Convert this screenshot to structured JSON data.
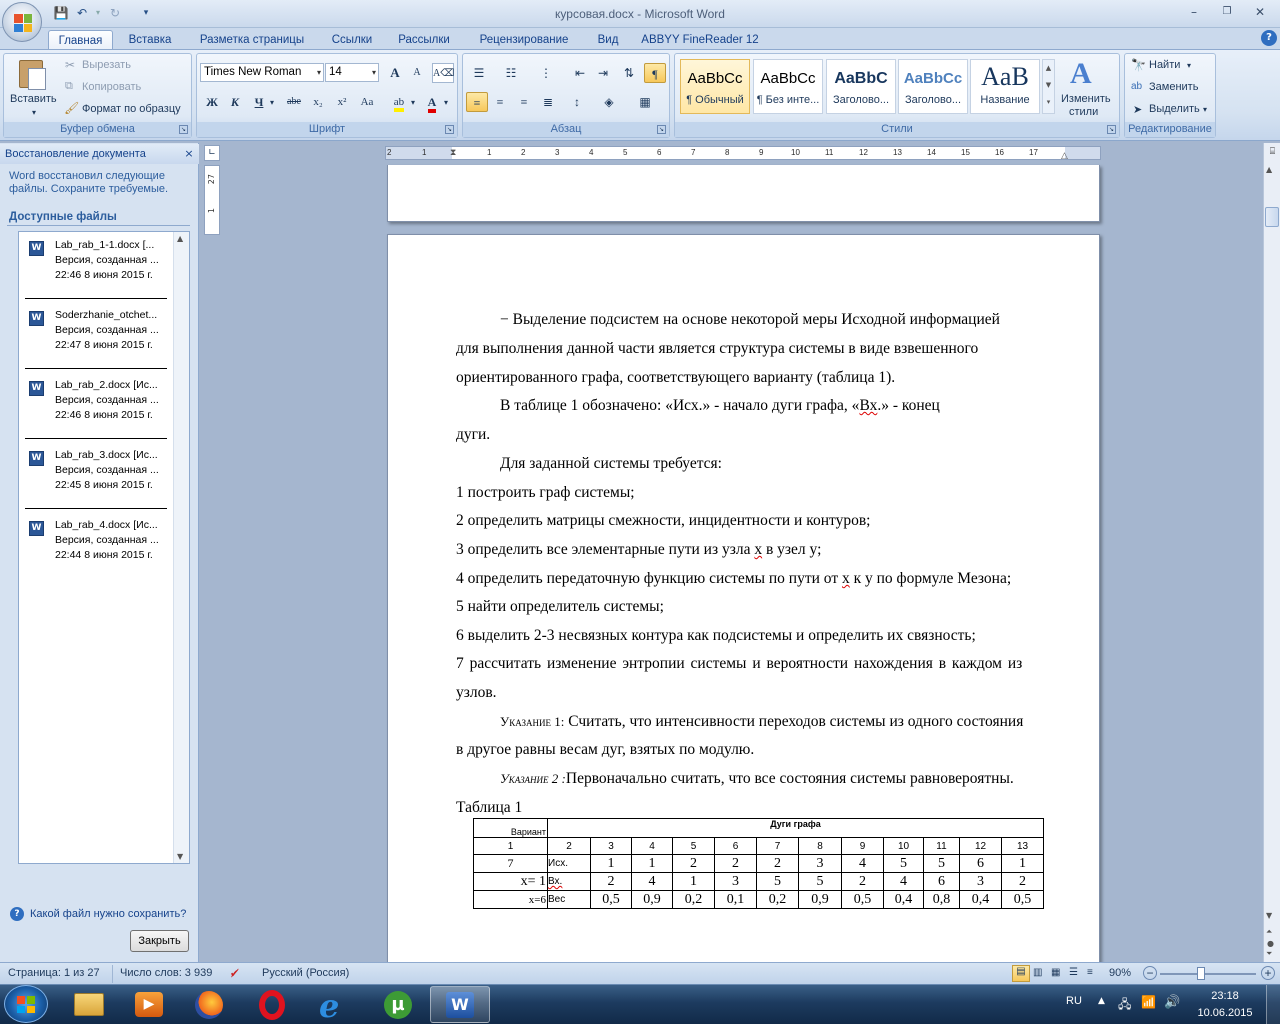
{
  "window": {
    "title": "курсовая.docx - Microsoft Word"
  },
  "ribbon": {
    "tabs": [
      "Главная",
      "Вставка",
      "Разметка страницы",
      "Ссылки",
      "Рассылки",
      "Рецензирование",
      "Вид",
      "ABBYY FineReader 12"
    ],
    "clipboard": {
      "paste": "Вставить",
      "cut": "Вырезать",
      "copy": "Копировать",
      "format_painter": "Формат по образцу",
      "label": "Буфер обмена"
    },
    "font": {
      "name": "Times New Roman",
      "size": "14",
      "label": "Шрифт",
      "bold": "Ж",
      "italic": "К",
      "underline": "Ч",
      "strike": "abe",
      "sub": "x₂",
      "sup": "x²",
      "case": "Aa",
      "grow": "A",
      "shrink": "A"
    },
    "paragraph": {
      "label": "Абзац"
    },
    "styles": {
      "label": "Стили",
      "items": [
        {
          "sample": "AaBbCc",
          "name": "¶ Обычный"
        },
        {
          "sample": "AaBbCc",
          "name": "¶ Без инте..."
        },
        {
          "sample": "AaBbC",
          "name": "Заголово..."
        },
        {
          "sample": "AaBbCc",
          "name": "Заголово..."
        },
        {
          "sample": "AaB",
          "name": "Название"
        }
      ],
      "change": "Изменить",
      "change2": "стили"
    },
    "editing": {
      "find": "Найти",
      "replace": "Заменить",
      "select": "Выделить",
      "label": "Редактирование"
    }
  },
  "ruler": {
    "numbers": [
      "2",
      "1",
      "1",
      "2",
      "3",
      "4",
      "5",
      "6",
      "7",
      "8",
      "9",
      "10",
      "11",
      "12",
      "13",
      "14",
      "15",
      "16",
      "17"
    ],
    "vnumbers": [
      "27",
      "1"
    ]
  },
  "taskpane": {
    "title": "Восстановление документа",
    "intro1": "Word восстановил следующие",
    "intro2": "файлы.  Сохраните требуемые.",
    "available": "Доступные файлы",
    "files": [
      {
        "name": "Lab_rab_1-1.docx  [...",
        "line2": "Версия, созданная ...",
        "time": "22:46 8 июня 2015 г."
      },
      {
        "name": "Soderzhanie_otchet...",
        "line2": "Версия, созданная ...",
        "time": "22:47 8 июня 2015 г."
      },
      {
        "name": "Lab_rab_2.docx  [Ис...",
        "line2": "Версия, созданная ...",
        "time": "22:46 8 июня 2015 г."
      },
      {
        "name": "Lab_rab_3.docx  [Ис...",
        "line2": "Версия, созданная ...",
        "time": "22:45 8 июня 2015 г."
      },
      {
        "name": "Lab_rab_4.docx  [Ис...",
        "line2": "Версия, созданная ...",
        "time": "22:44 8 июня 2015 г."
      }
    ],
    "help": "Какой файл нужно сохранить?",
    "close": "Закрыть"
  },
  "document": {
    "p1a": "− Выделение подсистем на основе некоторой меры Исходной информацией",
    "p1b": "для выполнения данной части является структура системы в виде взвешенного",
    "p1c": "ориентированного графа, соответствующего варианту (таблица 1).",
    "p2a_pre": "В таблице 1 обозначено: «Исх.» - начало дуги графа, «",
    "p2a_vx": "Вх",
    "p2a_post": ".» - конец",
    "p2b": "дуги.",
    "p3": "Для заданной системы требуется:",
    "list": [
      "1  построить граф системы;",
      "2  определить матрицы смежности, инцидентности и контуров;",
      "3  определить все элементарные пути из узла х в узел у;",
      "4  определить передаточную функцию системы по пути от х к у по формуле Мезона;",
      "5  найти определитель системы;",
      "6  выделить 2-3 несвязных контура как подсистемы и определить их связность;",
      "7  рассчитать изменение энтропии системы и вероятности нахождения в каждом из"
    ],
    "item3_pre": "3  определить все элементарные пути из узла ",
    "item3_x": "х",
    "item3_post": " в узел у;",
    "item4_pre": "4  определить передаточную функцию системы по пути от ",
    "item4_x": "х",
    "item4_post": " к у по формуле Мезона;",
    "list7b": "узлов.",
    "note1_label": "Указание 1:",
    "note1_text": " Считать, что интенсивности переходов системы из одного состояния",
    "note1b": "в другое равны весам дуг, взятых по модулю.",
    "note2_label": "Указание 2 :",
    "note2_text": "Первоначально считать, что все состояния системы равновероятны.",
    "table_caption": "Таблица 1",
    "table": {
      "variant": "Вариант",
      "arcs": "Дуги графа",
      "header_row": [
        "1",
        "2",
        "3",
        "4",
        "5",
        "6",
        "7",
        "8",
        "9",
        "10",
        "11",
        "12",
        "13"
      ],
      "row_variant": "7",
      "label_src": "Исх.",
      "label_dst": "Вх.",
      "label_weight": "Вес",
      "x_eq": "x= 1",
      "x_eq2": "x=6",
      "src": [
        "1",
        "1",
        "2",
        "2",
        "2",
        "3",
        "4",
        "5",
        "5",
        "6",
        "1"
      ],
      "dst": [
        "2",
        "4",
        "1",
        "3",
        "5",
        "5",
        "2",
        "4",
        "6",
        "3",
        "2"
      ],
      "weight": [
        "0,5",
        "0,9",
        "0,2",
        "0,1",
        "0,2",
        "0,9",
        "0,5",
        "0,4",
        "0,8",
        "0,4",
        "0,5"
      ]
    }
  },
  "statusbar": {
    "page": "Страница: 1 из 27",
    "words": "Число слов: 3 939",
    "lang": "Русский (Россия)",
    "zoom": "90%"
  },
  "taskbar": {
    "lang": "RU",
    "time": "23:18",
    "date": "10.06.2015"
  },
  "colors": {
    "ribbon_bg": "#dbe7f5",
    "doc_bg": "#a5b6cf",
    "taskbar": "#1d3b5f",
    "accent": "#15428b"
  }
}
